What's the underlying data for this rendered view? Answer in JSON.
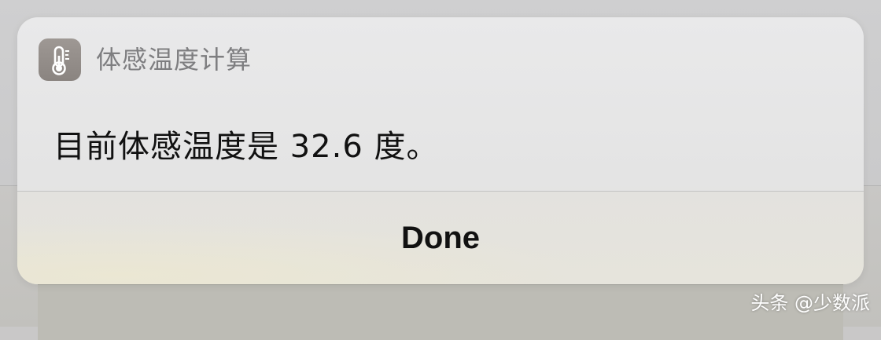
{
  "notification": {
    "app_title": "体感温度计算",
    "app_icon": "thermometer-icon",
    "message": "目前体感温度是 32.6 度。",
    "done_label": "Done"
  },
  "watermark": {
    "text": "头条 @少数派"
  },
  "colors": {
    "panel_bg": "#e7e7e8",
    "app_icon_bg": "#938d89",
    "app_title": "#7e7e80",
    "message_text": "#111111",
    "button_text": "#111111"
  }
}
